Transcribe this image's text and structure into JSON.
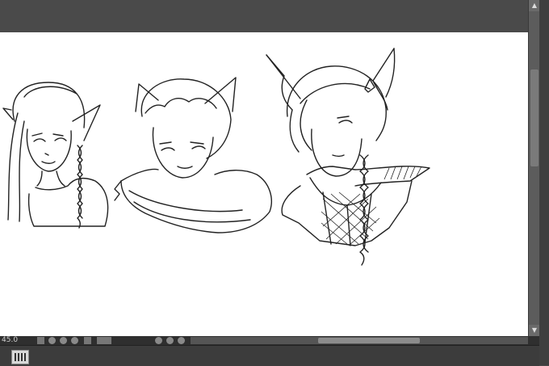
{
  "app": {
    "status": {
      "zoom_label": "45.0"
    }
  },
  "icons": {
    "rotate_left": "rotate-left-icon",
    "rotate_right": "rotate-right-icon",
    "reset": "reset-icon",
    "panel": "layer-panel-icon"
  },
  "colors": {
    "canvas": "#ffffff",
    "chrome": "#4a4a4a",
    "status": "#2f2f2f"
  }
}
